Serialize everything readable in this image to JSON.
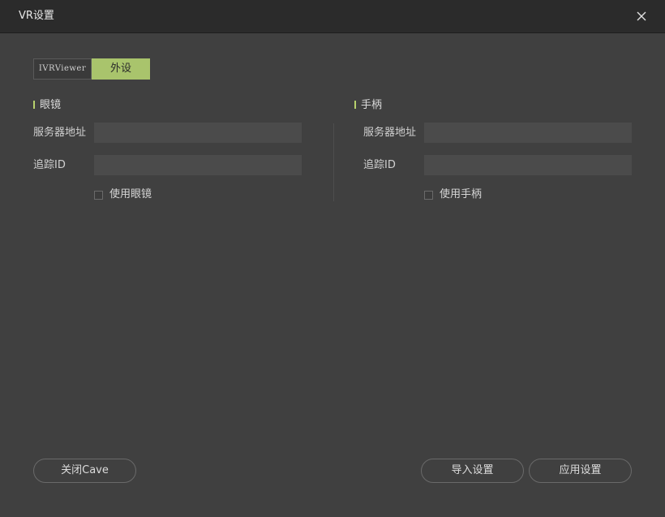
{
  "window": {
    "title": "VR设置",
    "close_icon": "close-icon"
  },
  "tabs": [
    {
      "label": "IVRViewer",
      "active": false
    },
    {
      "label": "外设",
      "active": true
    }
  ],
  "colors": {
    "accent": "#a9c46c",
    "background": "#404040",
    "titlebar": "#2b2b2b",
    "input_bg": "#4b4b4b"
  },
  "glasses": {
    "title": "眼镜",
    "server_label": "服务器地址",
    "server_value": "",
    "track_label": "追踪ID",
    "track_value": "",
    "use_label": "使用眼镜",
    "use_checked": false
  },
  "controller": {
    "title": "手柄",
    "server_label": "服务器地址",
    "server_value": "",
    "track_label": "追踪ID",
    "track_value": "",
    "use_label": "使用手柄",
    "use_checked": false
  },
  "buttons": {
    "close_cave": "关闭Cave",
    "import_settings": "导入设置",
    "apply_settings": "应用设置"
  }
}
